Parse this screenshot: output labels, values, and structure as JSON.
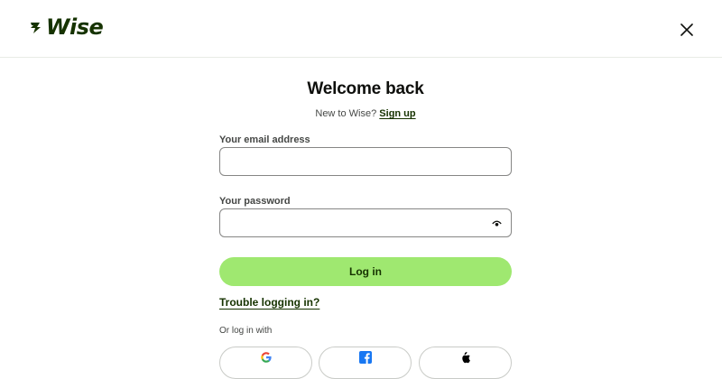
{
  "header": {
    "brand": "Wise",
    "brand_color": "#163300"
  },
  "main": {
    "title": "Welcome back",
    "signup_prompt": "New to Wise?",
    "signup_link": "Sign up",
    "email_label": "Your email address",
    "email_value": "",
    "password_label": "Your password",
    "password_value": "",
    "login_label": "Log in",
    "login_color": "#9fe870",
    "trouble_link": "Trouble logging in?",
    "social_label": "Or log in with",
    "social_buttons": [
      "google-icon",
      "facebook-icon",
      "apple-icon"
    ]
  }
}
